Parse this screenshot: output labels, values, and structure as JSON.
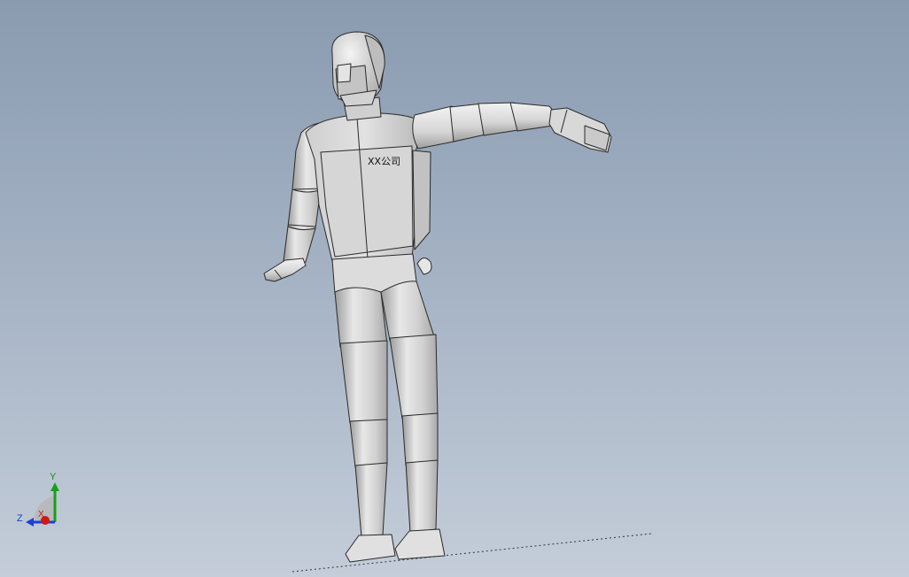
{
  "model": {
    "chest_label": "XX公司"
  },
  "triad": {
    "x_label": "X",
    "y_label": "Y",
    "z_label": "Z",
    "x_color": "#d01818",
    "y_color": "#18a018",
    "z_color": "#1e40d0"
  },
  "colors": {
    "background_top": "#8a9bb0",
    "background_bottom": "#c4cdd9",
    "part_fill": "#d9d9d9",
    "edge": "#2a2a2a"
  }
}
